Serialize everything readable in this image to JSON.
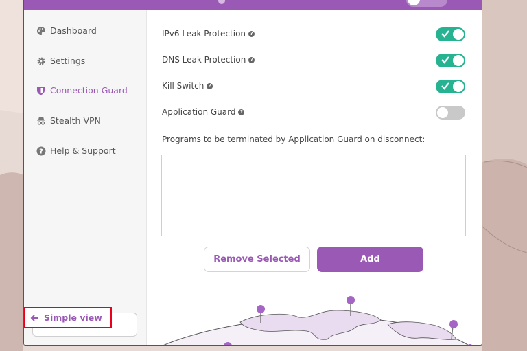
{
  "colors": {
    "accent": "#9b59b6",
    "toggle_on": "#26b391",
    "toggle_off": "#c9c9c9",
    "highlight": "#e8001c"
  },
  "sidebar": {
    "items": [
      {
        "label": "Dashboard",
        "icon": "palette-icon",
        "active": false
      },
      {
        "label": "Settings",
        "icon": "gear-icon",
        "active": false
      },
      {
        "label": "Connection Guard",
        "icon": "shield-icon",
        "active": true
      },
      {
        "label": "Stealth VPN",
        "icon": "incognito-icon",
        "active": false
      },
      {
        "label": "Help & Support",
        "icon": "question-circle-icon",
        "active": false
      }
    ],
    "simple_view_label": "Simple view"
  },
  "settings": [
    {
      "label": "IPv6 Leak Protection",
      "enabled": true
    },
    {
      "label": "DNS Leak Protection",
      "enabled": true
    },
    {
      "label": "Kill Switch",
      "enabled": true
    },
    {
      "label": "Application Guard",
      "enabled": false
    }
  ],
  "programs": {
    "label": "Programs to be terminated by Application Guard on disconnect:",
    "items": []
  },
  "buttons": {
    "remove_label": "Remove Selected",
    "add_label": "Add"
  }
}
